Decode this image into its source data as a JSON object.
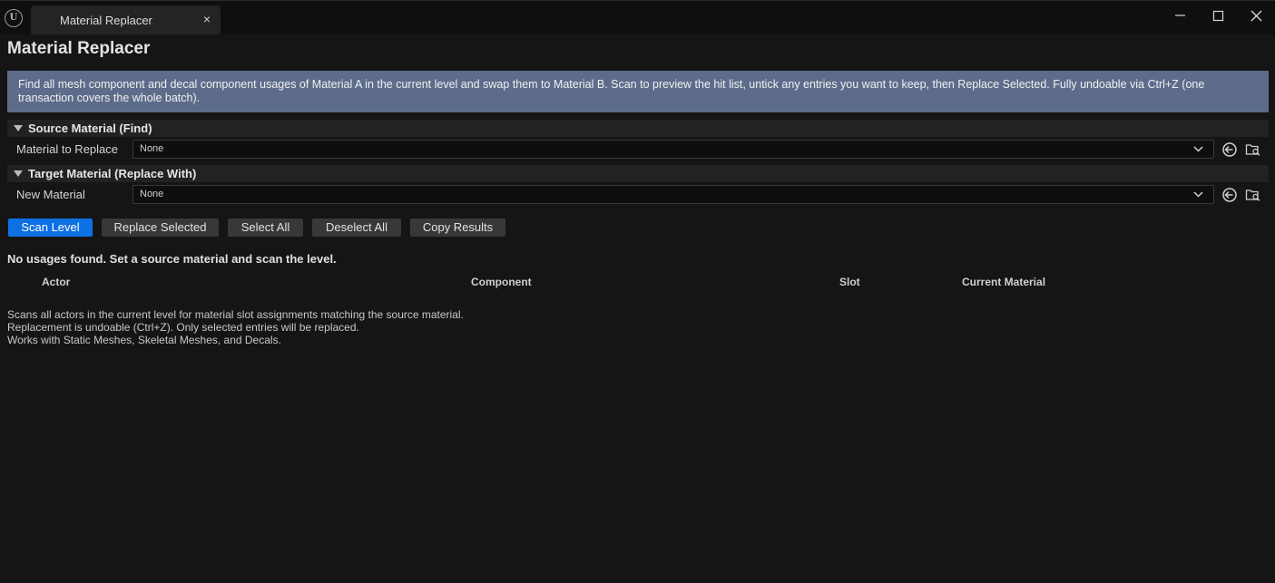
{
  "window": {
    "tab_title": "Material Replacer",
    "tab_close": "×"
  },
  "header": {
    "title": "Material Replacer"
  },
  "info": {
    "text": "Find all mesh component and decal component usages of Material A in the current level and swap them to Material B. Scan to preview the hit list, untick any entries you want to keep, then Replace Selected. Fully undoable via Ctrl+Z (one transaction covers the whole batch)."
  },
  "source": {
    "section_label": "Source Material (Find)",
    "property_label": "Material to Replace",
    "value": "None"
  },
  "target": {
    "section_label": "Target Material (Replace With)",
    "property_label": "New Material",
    "value": "None"
  },
  "toolbar": {
    "scan_label": "Scan Level",
    "replace_label": "Replace Selected",
    "select_all_label": "Select All",
    "deselect_all_label": "Deselect All",
    "copy_label": "Copy Results"
  },
  "results": {
    "status": "No usages found. Set a source material and scan the level.",
    "columns": [
      "Actor",
      "Component",
      "Slot",
      "Current Material"
    ],
    "rows": []
  },
  "notes": [
    "Scans all actors in the current level for material slot assignments matching the source material.",
    "Replacement is undoable (Ctrl+Z). Only selected entries will be replaced.",
    "Works with Static Meshes, Skeletal Meshes, and Decals."
  ],
  "colors": {
    "accent": "#0e71e3",
    "info_background": "#5d6c8a",
    "background": "#151515"
  }
}
